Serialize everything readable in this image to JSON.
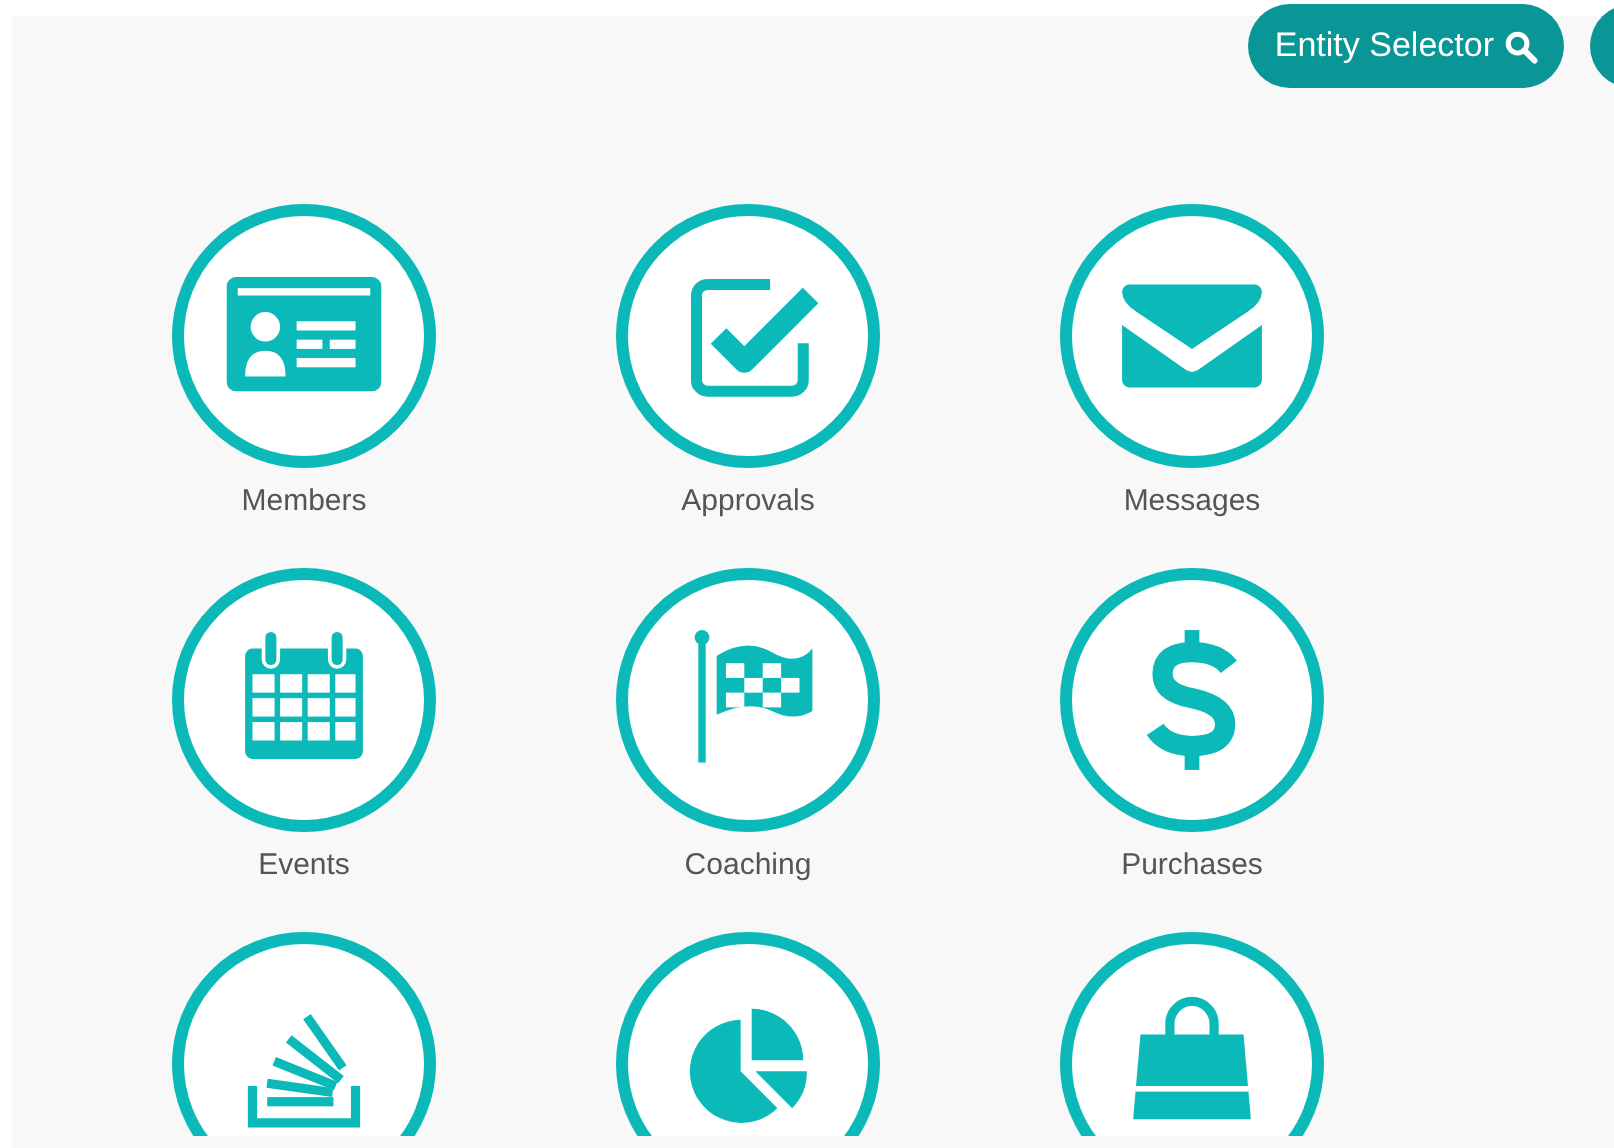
{
  "header": {
    "buttons": [
      {
        "label": "Entity Selector",
        "cut_off": false
      },
      {
        "cut_off": true
      }
    ]
  },
  "tiles": [
    {
      "label": "Members",
      "cut_off": false
    },
    {
      "label": "Approvals",
      "cut_off": false
    },
    {
      "label": "Messages",
      "cut_off": false
    },
    {
      "label": "Events",
      "cut_off": false
    },
    {
      "label": "Coaching",
      "cut_off": false
    },
    {
      "label": "Purchases",
      "cut_off": false
    },
    {
      "cut_off": true
    },
    {
      "cut_off": true
    },
    {
      "cut_off": true
    }
  ]
}
